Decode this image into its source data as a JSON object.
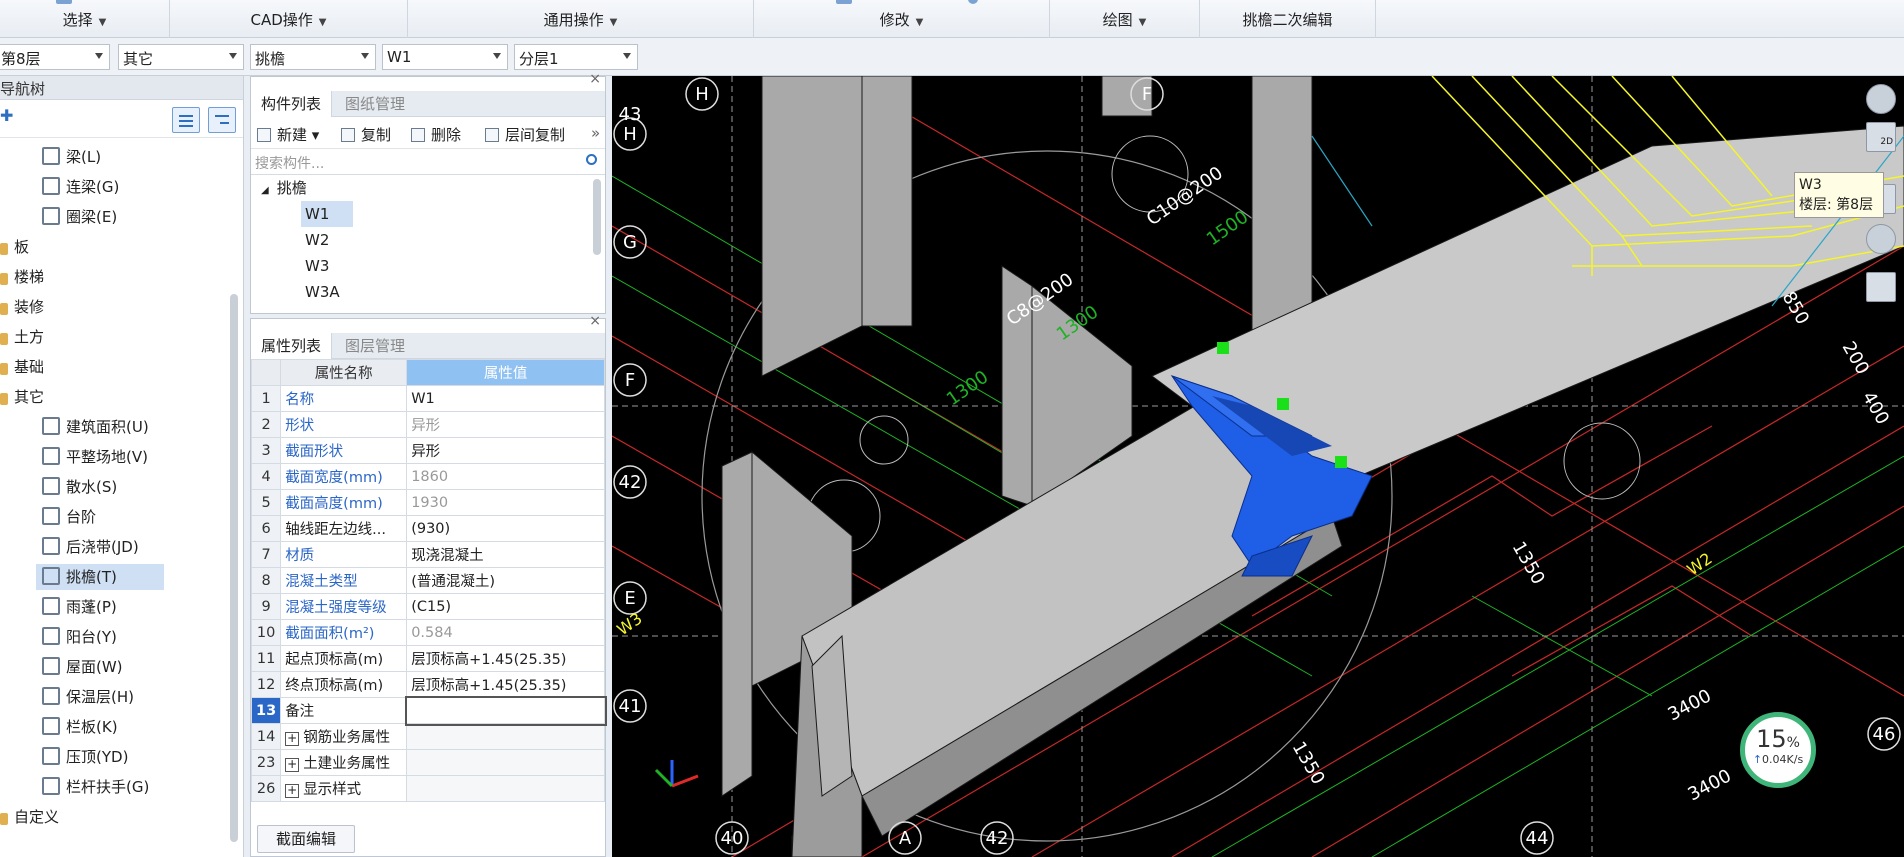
{
  "ribbon": {
    "groups": [
      {
        "label": "选择"
      },
      {
        "label": "CAD操作"
      },
      {
        "label": "通用操作"
      },
      {
        "label": "修改"
      },
      {
        "label": "绘图"
      },
      {
        "label": "挑檐二次编辑"
      }
    ]
  },
  "selectors": [
    "第8层",
    "其它",
    "挑檐",
    "W1",
    "分层1"
  ],
  "nav": {
    "title": "导航树",
    "items": [
      {
        "label": "梁(L)",
        "type": "sub"
      },
      {
        "label": "连梁(G)",
        "type": "sub"
      },
      {
        "label": "圈梁(E)",
        "type": "sub"
      },
      {
        "label": "板",
        "type": "folder"
      },
      {
        "label": "楼梯",
        "type": "folder"
      },
      {
        "label": "装修",
        "type": "folder"
      },
      {
        "label": "土方",
        "type": "folder"
      },
      {
        "label": "基础",
        "type": "folder"
      },
      {
        "label": "其它",
        "type": "folder"
      },
      {
        "label": "建筑面积(U)",
        "type": "sub"
      },
      {
        "label": "平整场地(V)",
        "type": "sub"
      },
      {
        "label": "散水(S)",
        "type": "sub"
      },
      {
        "label": "台阶",
        "type": "sub"
      },
      {
        "label": "后浇带(JD)",
        "type": "sub"
      },
      {
        "label": "挑檐(T)",
        "type": "sub",
        "selected": true
      },
      {
        "label": "雨蓬(P)",
        "type": "sub"
      },
      {
        "label": "阳台(Y)",
        "type": "sub"
      },
      {
        "label": "屋面(W)",
        "type": "sub"
      },
      {
        "label": "保温层(H)",
        "type": "sub"
      },
      {
        "label": "栏板(K)",
        "type": "sub"
      },
      {
        "label": "压顶(YD)",
        "type": "sub"
      },
      {
        "label": "栏杆扶手(G)",
        "type": "sub"
      },
      {
        "label": "自定义",
        "type": "folder"
      }
    ]
  },
  "component_panel": {
    "tabs": [
      "构件列表",
      "图纸管理"
    ],
    "toolbar": {
      "new": "新建",
      "copy": "复制",
      "delete": "删除",
      "floor_copy": "层间复制"
    },
    "search_placeholder": "搜索构件...",
    "group": "挑檐",
    "items": [
      "W1",
      "W2",
      "W3",
      "W3A"
    ]
  },
  "property_panel": {
    "tabs": [
      "属性列表",
      "图层管理"
    ],
    "col_name": "属性名称",
    "col_value": "属性值",
    "rows": [
      {
        "n": "1",
        "name": "名称",
        "value": "W1",
        "nameColor": "blue",
        "valColor": "normal"
      },
      {
        "n": "2",
        "name": "形状",
        "value": "异形",
        "nameColor": "blue",
        "valColor": "gray"
      },
      {
        "n": "3",
        "name": "截面形状",
        "value": "异形",
        "nameColor": "blue",
        "valColor": "normal"
      },
      {
        "n": "4",
        "name": "截面宽度(mm)",
        "value": "1860",
        "nameColor": "blue",
        "valColor": "gray"
      },
      {
        "n": "5",
        "name": "截面高度(mm)",
        "value": "1930",
        "nameColor": "blue",
        "valColor": "gray"
      },
      {
        "n": "6",
        "name": "轴线距左边线...",
        "value": "(930)",
        "nameColor": "normal",
        "valColor": "normal"
      },
      {
        "n": "7",
        "name": "材质",
        "value": "现浇混凝土",
        "nameColor": "blue",
        "valColor": "normal"
      },
      {
        "n": "8",
        "name": "混凝土类型",
        "value": "(普通混凝土)",
        "nameColor": "blue",
        "valColor": "normal"
      },
      {
        "n": "9",
        "name": "混凝土强度等级",
        "value": "(C15)",
        "nameColor": "blue",
        "valColor": "normal"
      },
      {
        "n": "10",
        "name": "截面面积(m²)",
        "value": "0.584",
        "nameColor": "blue",
        "valColor": "gray"
      },
      {
        "n": "11",
        "name": "起点顶标高(m)",
        "value": "层顶标高+1.45(25.35)",
        "nameColor": "normal",
        "valColor": "normal"
      },
      {
        "n": "12",
        "name": "终点顶标高(m)",
        "value": "层顶标高+1.45(25.35)",
        "nameColor": "normal",
        "valColor": "normal"
      },
      {
        "n": "13",
        "name": "备注",
        "value": "",
        "nameColor": "normal",
        "valColor": "normal",
        "selected": true
      },
      {
        "n": "14",
        "name": "钢筋业务属性",
        "value": "",
        "nameColor": "normal",
        "valColor": "normal",
        "expand": true
      },
      {
        "n": "23",
        "name": "土建业务属性",
        "value": "",
        "nameColor": "normal",
        "valColor": "normal",
        "expand": true
      },
      {
        "n": "26",
        "name": "显示样式",
        "value": "",
        "nameColor": "normal",
        "valColor": "normal",
        "expand": true
      }
    ],
    "edit_button": "截面编辑"
  },
  "viewport": {
    "tooltip_line1": "W3",
    "tooltip_line2": "楼层: 第8层",
    "gauge_percent": "15",
    "gauge_unit": "%",
    "gauge_speed": "0.04K/s",
    "axis_labels": [
      "H",
      "F",
      "43",
      "H",
      "G",
      "F",
      "42",
      "E",
      "41",
      "46",
      "40",
      "A",
      "42",
      "44"
    ],
    "cad_texts": [
      "C10@200",
      "C8@200",
      "1500",
      "1300",
      "1300",
      "3400",
      "3400",
      "1350",
      "1350",
      "200",
      "850",
      "400",
      "W2",
      "W3"
    ],
    "tool_label_2d": "2D"
  },
  "colors": {
    "accent": "#2b67c7",
    "header_blue": "#8fc1f2",
    "element_blue": "#1f5ee6",
    "highlight_yellow": "#f5f52a"
  }
}
